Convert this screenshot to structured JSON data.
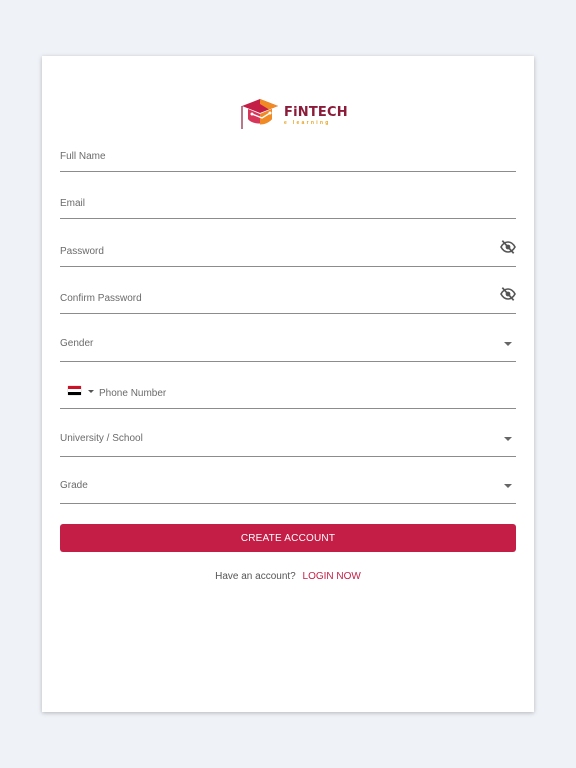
{
  "logo": {
    "title": "FiNTECH",
    "subtitle": "e learning",
    "colors": {
      "primary": "#c41d46",
      "secondary": "#f08a24",
      "text": "#8a1c3a"
    }
  },
  "form": {
    "full_name": {
      "placeholder": "Full Name",
      "value": ""
    },
    "email": {
      "placeholder": "Email",
      "value": ""
    },
    "password": {
      "placeholder": "Password",
      "value": "",
      "icon": "eye-off-icon"
    },
    "confirm_password": {
      "placeholder": "Confirm Password",
      "value": "",
      "icon": "eye-off-icon"
    },
    "gender": {
      "label": "Gender",
      "icon": "caret-down-icon"
    },
    "phone": {
      "placeholder": "Phone Number",
      "value": "",
      "country_icon": "egypt-flag-icon"
    },
    "university": {
      "label": "University / School",
      "icon": "caret-down-icon"
    },
    "grade": {
      "label": "Grade",
      "icon": "caret-down-icon"
    }
  },
  "actions": {
    "create_account": "CREATE ACCOUNT",
    "have_account": "Have an account?",
    "login_now": "LOGIN NOW"
  },
  "colors": {
    "accent": "#c41d46",
    "background": "#eff2f7",
    "card": "#ffffff",
    "underline": "#8c8c8c"
  }
}
